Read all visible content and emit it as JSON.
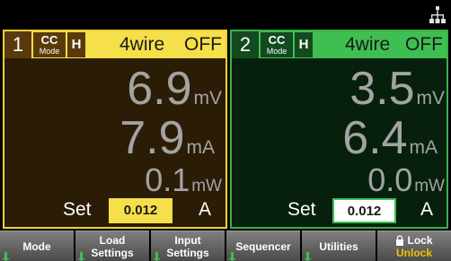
{
  "status_bar": {
    "lan_icon": "lan-network-icon"
  },
  "channels": [
    {
      "number": "1",
      "mode": "CC",
      "mode_sub": "Mode",
      "range": "H",
      "sense": "4wire",
      "state": "OFF",
      "voltage": {
        "value": "6.9",
        "unit": "mV"
      },
      "current": {
        "value": "7.9",
        "unit": "mA"
      },
      "power": {
        "value": "0.1",
        "unit": "mW"
      },
      "set_label": "Set",
      "set_value": "0.012",
      "set_unit": "A",
      "accent_color": "#f5df4a"
    },
    {
      "number": "2",
      "mode": "CC",
      "mode_sub": "Mode",
      "range": "H",
      "sense": "4wire",
      "state": "OFF",
      "voltage": {
        "value": "3.5",
        "unit": "mV"
      },
      "current": {
        "value": "6.4",
        "unit": "mA"
      },
      "power": {
        "value": "0.0",
        "unit": "mW"
      },
      "set_label": "Set",
      "set_value": "0.012",
      "set_unit": "A",
      "accent_color": "#3fbf52"
    }
  ],
  "softkeys": {
    "mode": "Mode",
    "load_1": "Load",
    "load_2": "Settings",
    "input_1": "Input",
    "input_2": "Settings",
    "sequencer": "Sequencer",
    "utilities": "Utilities",
    "lock_1": "Lock",
    "lock_2": "Unlock"
  }
}
